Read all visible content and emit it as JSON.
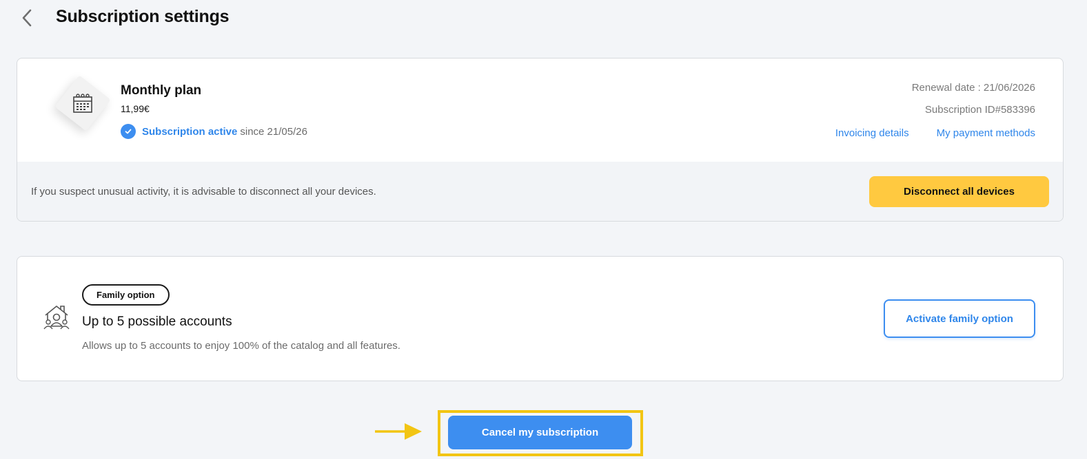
{
  "header": {
    "title": "Subscription settings",
    "back_icon": "chevron-left-icon"
  },
  "plan": {
    "icon": "calendar-icon",
    "name": "Monthly plan",
    "price": "11,99€",
    "status_active": "Subscription active",
    "status_since": "since 21/05/26",
    "renewal": "Renewal date : 21/06/2026",
    "subscription_id": "Subscription ID#583396",
    "links": {
      "invoicing": "Invoicing details",
      "payment": "My payment methods"
    },
    "footer_text": "If you suspect unusual activity, it is advisable to disconnect all your devices.",
    "disconnect_label": "Disconnect all devices"
  },
  "family": {
    "icon": "family-home-icon",
    "badge": "Family option",
    "title": "Up to 5 possible accounts",
    "description": "Allows up to 5 accounts to enjoy 100% of the catalog and all features.",
    "activate_label": "Activate family option"
  },
  "cancel": {
    "label": "Cancel my subscription",
    "pointer_icon": "arrow-right-icon"
  },
  "colors": {
    "accent": "#3d8ef0",
    "warning_button": "#ffc940",
    "highlight": "#f2c513",
    "background": "#f3f5f8"
  }
}
